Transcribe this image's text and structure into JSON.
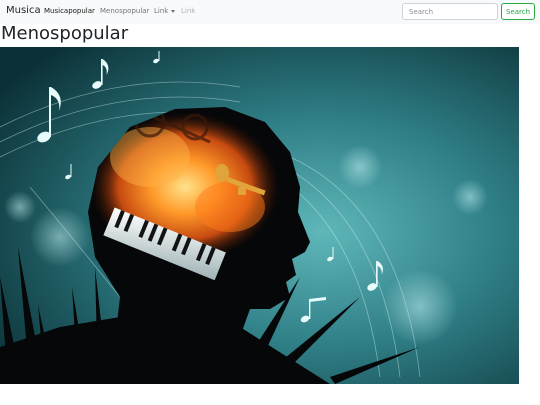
{
  "navbar": {
    "brand": "Musica",
    "links": [
      {
        "label": "Musicapopular",
        "active": true
      },
      {
        "label": "Menospopular",
        "active": false
      },
      {
        "label": "Link",
        "dropdown": true
      },
      {
        "label": "Link",
        "disabled": true
      }
    ],
    "search": {
      "placeholder": "Search",
      "button_label": "Search"
    }
  },
  "main": {
    "title": "Menospopular",
    "hero_image": {
      "icon": "music-head-silhouette-image",
      "colors": {
        "bg_dark": "#0d3b40",
        "bg_light": "#4aa3a8",
        "fire": "#ff8a1e"
      }
    }
  }
}
